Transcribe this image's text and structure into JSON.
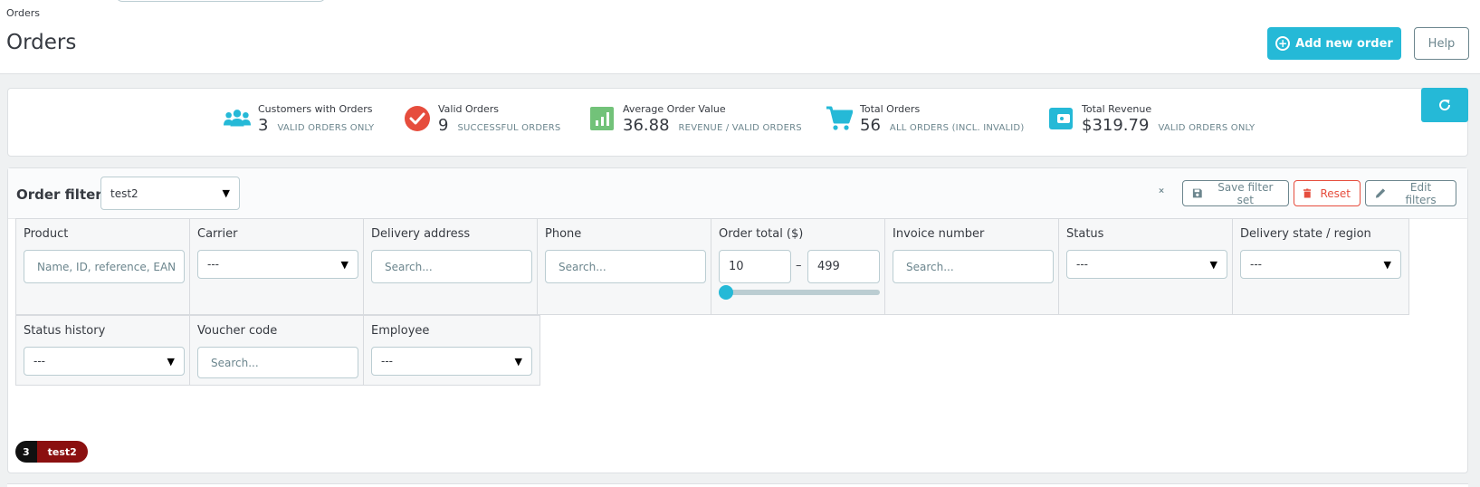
{
  "breadcrumb": "Orders",
  "page_title": "Orders",
  "toolbar": {
    "add_new_order": "Add new order",
    "help": "Help"
  },
  "kpis": [
    {
      "title": "Customers with Orders",
      "value": "3",
      "sub": "VALID ORDERS ONLY",
      "icon": "users-icon",
      "color": "#25b9d7"
    },
    {
      "title": "Valid Orders",
      "value": "9",
      "sub": "SUCCESSFUL ORDERS",
      "icon": "check-circle-icon",
      "color": "#e64d3d"
    },
    {
      "title": "Average Order Value",
      "value": "36.88",
      "sub": "REVENUE / VALID ORDERS",
      "icon": "bar-chart-icon",
      "color": "#72c279"
    },
    {
      "title": "Total Orders",
      "value": "56",
      "sub": "ALL ORDERS (INCL. INVALID)",
      "icon": "cart-icon",
      "color": "#25b9d7"
    },
    {
      "title": "Total Revenue",
      "value": "$319.79",
      "sub": "VALID ORDERS ONLY",
      "icon": "wallet-icon",
      "color": "#25b9d7"
    }
  ],
  "filter": {
    "title": "Order filter",
    "selected_set": "test2",
    "save_label": "Save filter set",
    "reset_label": "Reset",
    "edit_label": "Edit filters",
    "fields": {
      "product": {
        "label": "Product",
        "placeholder": "Name, ID, reference, EAN"
      },
      "carrier": {
        "label": "Carrier",
        "value": "---"
      },
      "delivery_address": {
        "label": "Delivery address",
        "placeholder": "Search..."
      },
      "phone": {
        "label": "Phone",
        "placeholder": "Search..."
      },
      "order_total": {
        "label": "Order total ($)",
        "min": "10",
        "max": "499",
        "separator": "–"
      },
      "invoice_number": {
        "label": "Invoice number",
        "placeholder": "Search..."
      },
      "status": {
        "label": "Status",
        "value": "---"
      },
      "delivery_state": {
        "label": "Delivery state / region",
        "value": "---"
      },
      "status_history": {
        "label": "Status history",
        "value": "---"
      },
      "voucher_code": {
        "label": "Voucher code",
        "placeholder": "Search..."
      },
      "employee": {
        "label": "Employee",
        "value": "---"
      }
    },
    "active_tag": {
      "count": "3",
      "name": "test2"
    }
  }
}
